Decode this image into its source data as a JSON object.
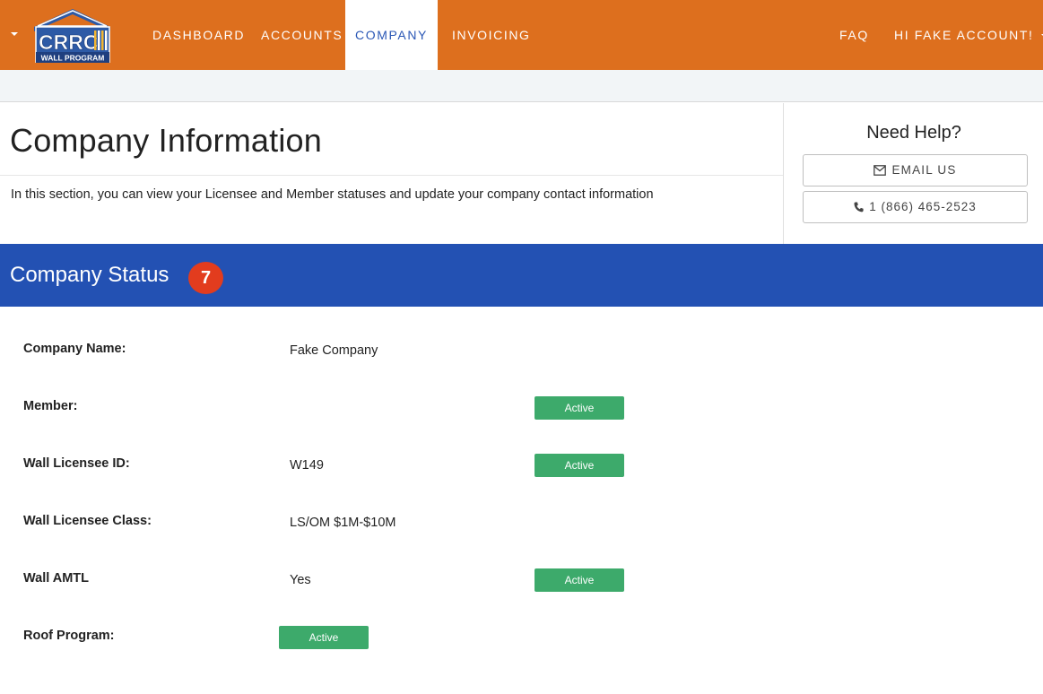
{
  "navbar": {
    "logo_text": "CRRC",
    "logo_sub": "WALL PROGRAM",
    "items": [
      {
        "label": "DASHBOARD"
      },
      {
        "label": "ACCOUNTS"
      },
      {
        "label": "COMPANY"
      },
      {
        "label": "INVOICING"
      }
    ],
    "active": "COMPANY",
    "faq": "FAQ",
    "user": "HI FAKE ACCOUNT!",
    "brand_color": "#dd6f1e",
    "active_text_color": "#2a57b5"
  },
  "page": {
    "title": "Company Information",
    "intro": "In this section, you can view your Licensee and Member statuses and update your company contact information"
  },
  "help": {
    "title": "Need Help?",
    "email_label": "EMAIL US",
    "email_icon": "envelope-icon",
    "phone_label": "1 (866) 465-2523",
    "phone_icon": "phone-icon"
  },
  "status": {
    "title": "Company Status",
    "badge": "7",
    "bar_color": "#2351b3",
    "badge_color": "#e23c1e",
    "pill_color": "#3daa6b",
    "rows": [
      {
        "label": "Company Name:",
        "value": "Fake Company",
        "status": ""
      },
      {
        "label": "Member:",
        "value": "",
        "status": "Active"
      },
      {
        "label": "Wall Licensee ID:",
        "value": "W149",
        "status": "Active"
      },
      {
        "label": "Wall Licensee Class:",
        "value": "LS/OM $1M-$10M",
        "status": ""
      },
      {
        "label": "Wall AMTL",
        "value": "Yes",
        "status": "Active"
      },
      {
        "label": "Roof Program:",
        "value": "",
        "status": "Active"
      }
    ]
  }
}
